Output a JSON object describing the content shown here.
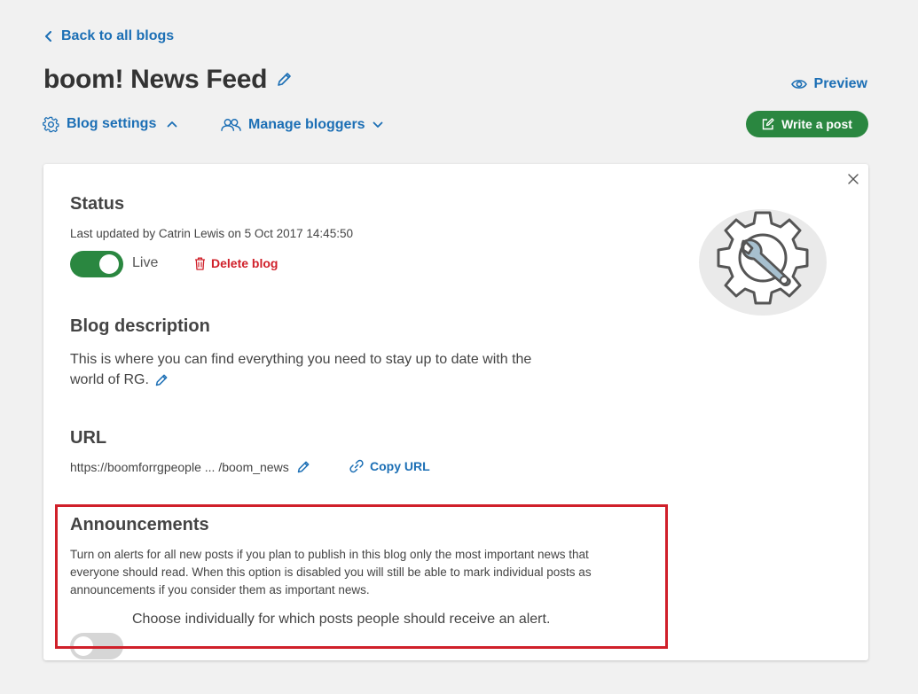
{
  "nav": {
    "back_label": "Back to all blogs",
    "preview_label": "Preview",
    "write_post_label": "Write a post"
  },
  "header": {
    "title": "boom! News Feed"
  },
  "tabs": {
    "blog_settings_label": "Blog settings",
    "manage_bloggers_label": "Manage bloggers"
  },
  "status": {
    "title": "Status",
    "last_updated": "Last updated by Catrin Lewis on 5 Oct 2017 14:45:50",
    "live_label": "Live",
    "live_on": true,
    "delete_label": "Delete blog"
  },
  "description": {
    "title": "Blog description",
    "text_line1": "This is where you can find everything you need to stay up to date with the",
    "text_line2": "world of RG."
  },
  "url": {
    "title": "URL",
    "value": "https://boomforrgpeople ... /boom_news",
    "copy_label": "Copy URL"
  },
  "announcements": {
    "title": "Announcements",
    "line1": "Turn on alerts for all new posts if you plan to publish in this blog only the most important news that",
    "line2": "everyone should read. When this option is disabled you will still be able to mark individual posts as",
    "line3": "announcements if you consider them as important news.",
    "toggle_label": "Choose individually for which posts people should receive an alert.",
    "toggle_on": false
  },
  "colors": {
    "accent": "#1c6fb5",
    "success": "#2a8740",
    "danger": "#d0202a",
    "background": "#f1f1f1"
  }
}
